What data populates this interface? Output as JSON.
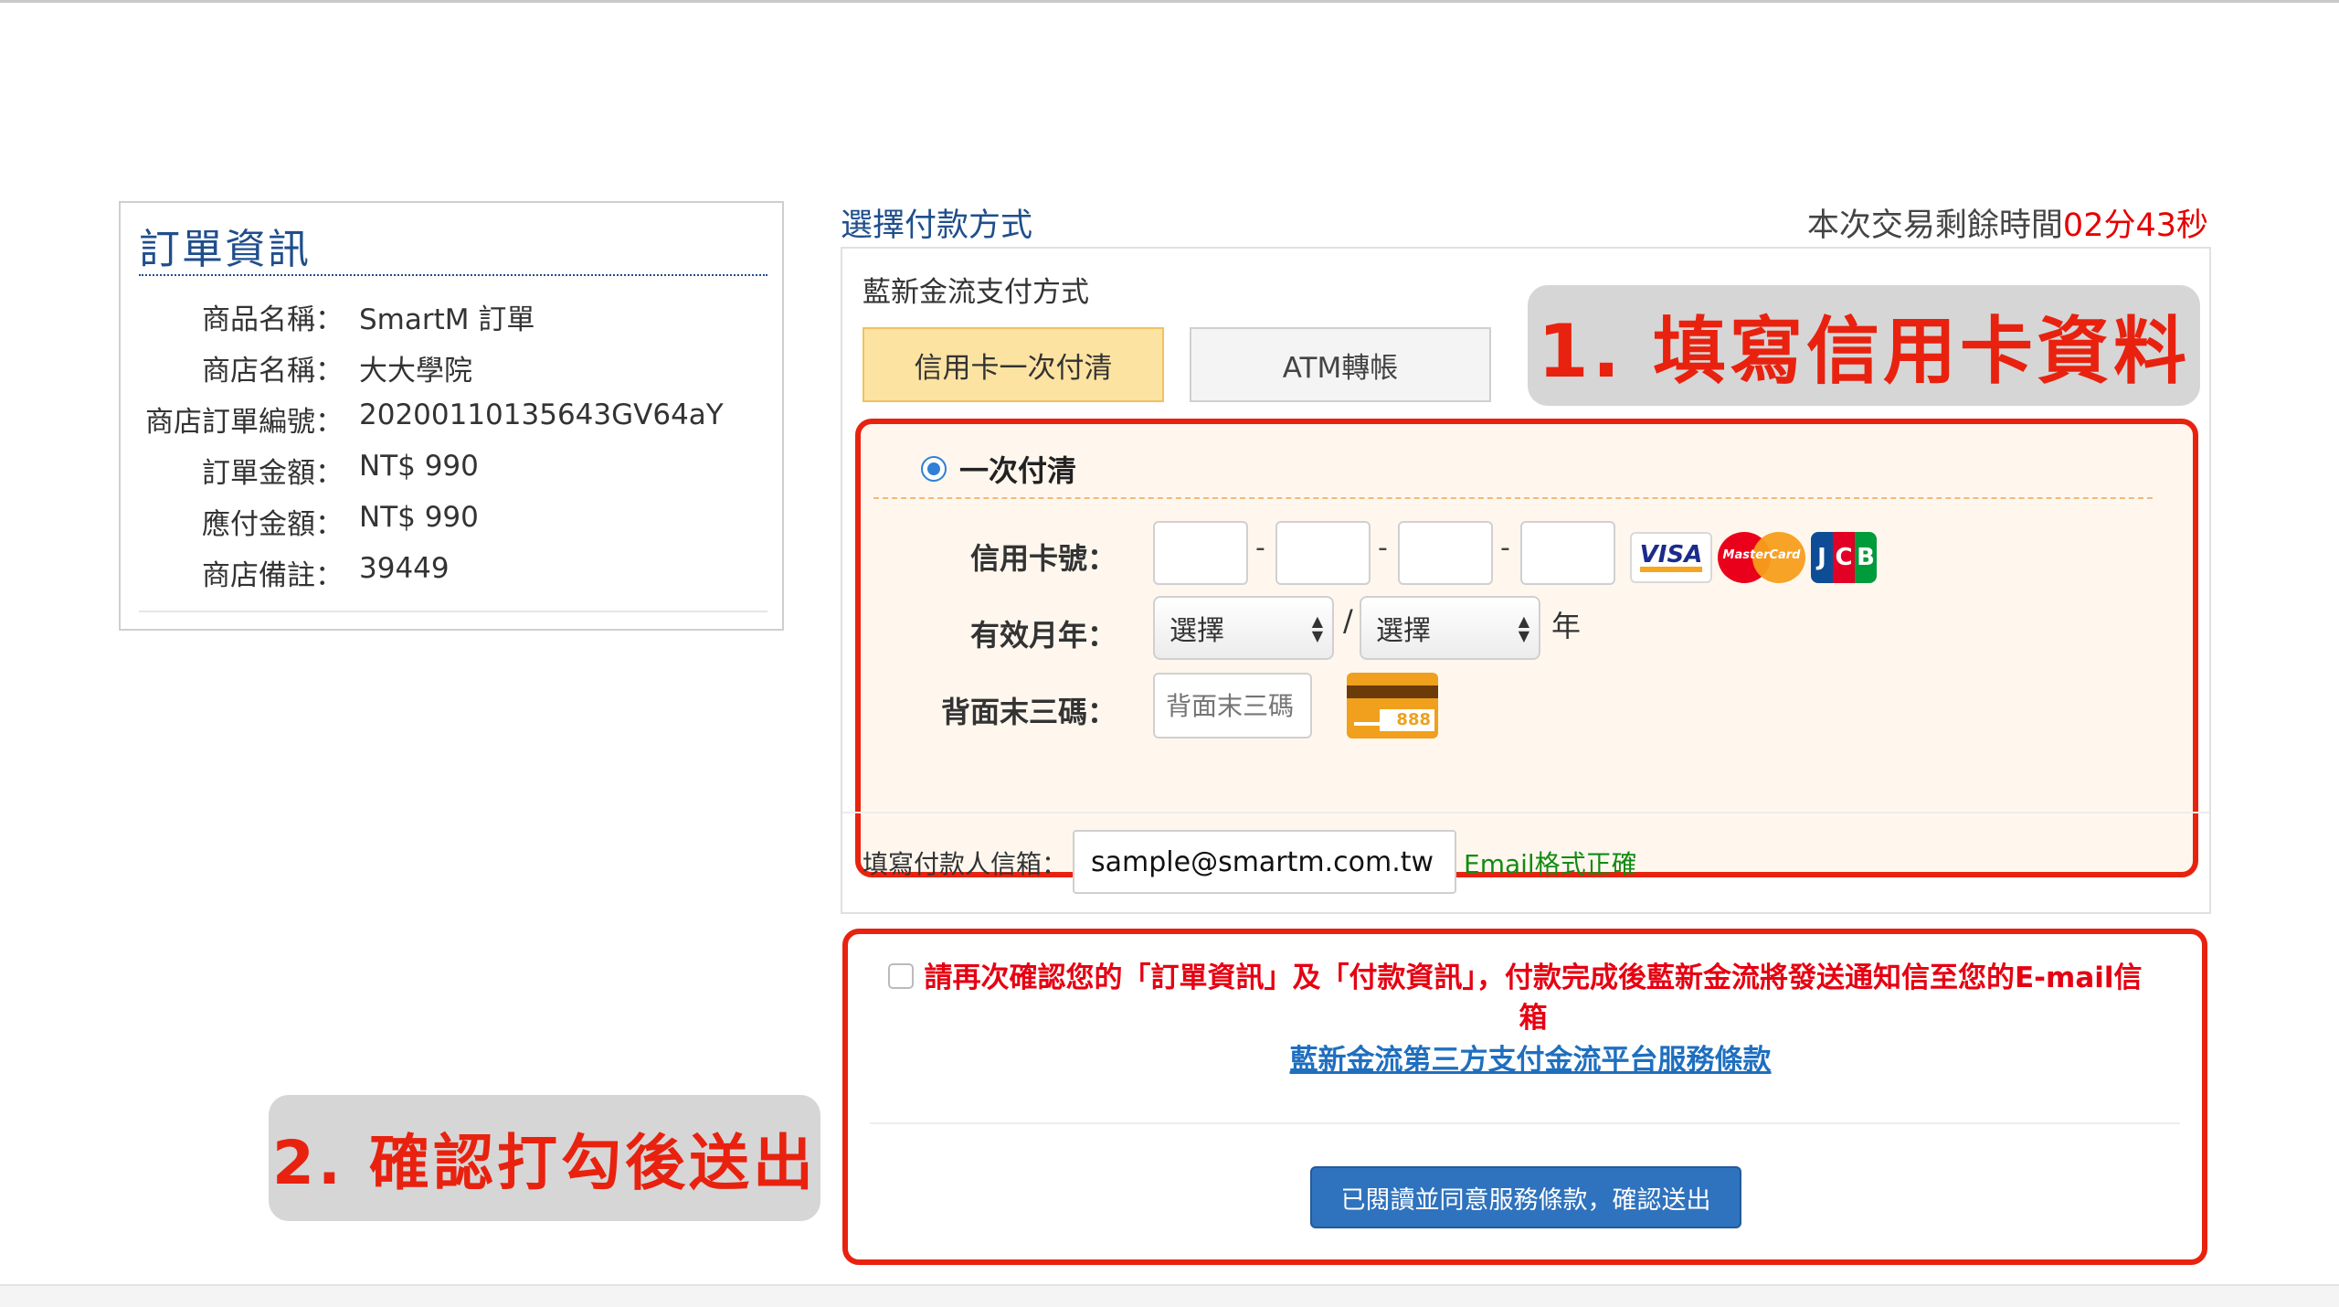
{
  "order": {
    "title": "訂單資訊",
    "rows": [
      {
        "label": "商品名稱：",
        "value": "SmartM 訂單"
      },
      {
        "label": "商店名稱：",
        "value": "大大學院"
      },
      {
        "label": "商店訂單編號：",
        "value": "20200110135643GV64aY"
      },
      {
        "label": "訂單金額：",
        "value": "NT$ 990"
      },
      {
        "label": "應付金額：",
        "value": "NT$ 990"
      },
      {
        "label": "商店備註：",
        "value": "39449"
      }
    ]
  },
  "payment": {
    "heading": "選擇付款方式",
    "timer_label": "本次交易剩餘時間",
    "timer_value": "02分43秒",
    "provider_label": "藍新金流支付方式",
    "tabs": [
      {
        "label": "信用卡一次付清",
        "active": true
      },
      {
        "label": "ATM轉帳",
        "active": false
      }
    ],
    "option_label": "一次付清",
    "card_number_label": "信用卡號：",
    "card_number_separator": "-",
    "brands": [
      "VISA",
      "MasterCard",
      "JCB"
    ],
    "expiry_label": "有效月年：",
    "month_select": "選擇",
    "year_select": "選擇",
    "expiry_separator": "/",
    "year_suffix": "年",
    "cvc_label": "背面末三碼：",
    "cvc_placeholder": "背面末三碼",
    "cvc_icon_number": "888",
    "email_label": "填寫付款人信箱：",
    "email_value": "sample@smartm.com.tw",
    "email_status": "Email格式正確"
  },
  "confirm": {
    "text": "請再次確認您的「訂單資訊」及「付款資訊」，付款完成後藍新金流將發送通知信至您的E-mail信箱",
    "terms_link": "藍新金流第三方支付金流平台服務條款",
    "submit_label": "已閱讀並同意服務條款，確認送出",
    "checked": false
  },
  "annotations": {
    "step1": "1. 填寫信用卡資料",
    "step2": "2. 確認打勾後送出"
  },
  "colors": {
    "accent_red": "#e8220f",
    "link_blue": "#1f6fbf",
    "heading_blue": "#1f4e8c",
    "valid_green": "#128a12",
    "tab_active_bg": "#fde3a2",
    "submit_bg": "#2f72bd"
  }
}
